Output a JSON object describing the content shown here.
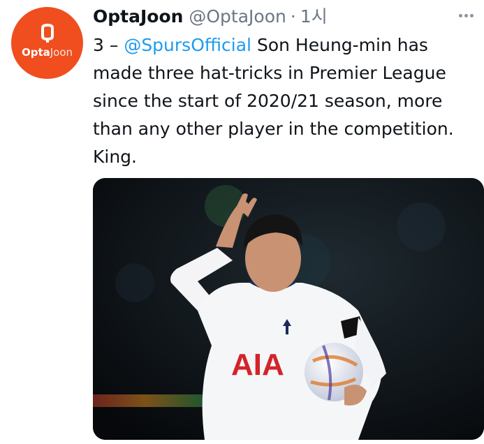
{
  "tweet": {
    "display_name": "OptaJoon",
    "handle": "@OptaJoon",
    "separator": "·",
    "time": "1시",
    "text_before_mention": "3 – ",
    "mention": "@SpursOfficial",
    "text_after_mention": " Son Heung-min has made three hat-tricks in Premier League since the start of 2020/21 season, more than any other player in the competition. King."
  },
  "avatar": {
    "brand_part1": "Opta",
    "brand_part2": "Joon",
    "color": "#f04e1f"
  },
  "media": {
    "subject": "footballer-waving-holding-match-ball",
    "shirt_sponsor": "AIA"
  },
  "colors": {
    "link": "#1d9bf0",
    "text": "#0f1419",
    "muted": "#6b7785"
  }
}
